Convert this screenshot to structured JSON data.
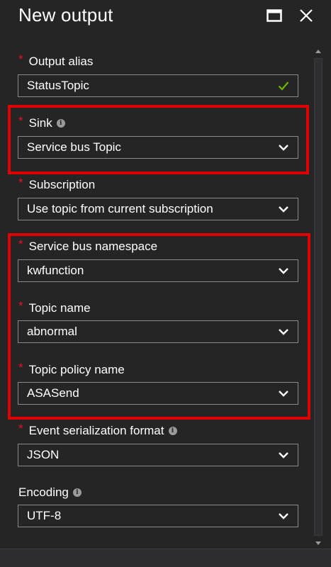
{
  "header": {
    "title": "New output"
  },
  "form": {
    "output_alias": {
      "label": "Output alias",
      "value": "StatusTopic"
    },
    "sink": {
      "label": "Sink",
      "value": "Service bus Topic"
    },
    "subscription": {
      "label": "Subscription",
      "value": "Use topic from current subscription"
    },
    "namespace": {
      "label": "Service bus namespace",
      "value": "kwfunction"
    },
    "topic_name": {
      "label": "Topic name",
      "value": "abnormal"
    },
    "topic_policy": {
      "label": "Topic policy name",
      "value": "ASASend"
    },
    "serialization": {
      "label": "Event serialization format",
      "value": "JSON"
    },
    "encoding": {
      "label": "Encoding",
      "value": "UTF-8"
    }
  },
  "required_mark": "*",
  "info_glyph": "i",
  "colors": {
    "background": "#252526",
    "required": "#e81123",
    "valid_check": "#6bb700",
    "highlight": "#e00000",
    "field_border": "#8a8a8a"
  },
  "icons": {
    "maximize": "maximize-icon",
    "close": "close-icon",
    "chevron": "chevron-down-icon",
    "check": "checkmark-icon",
    "info": "info-icon"
  }
}
